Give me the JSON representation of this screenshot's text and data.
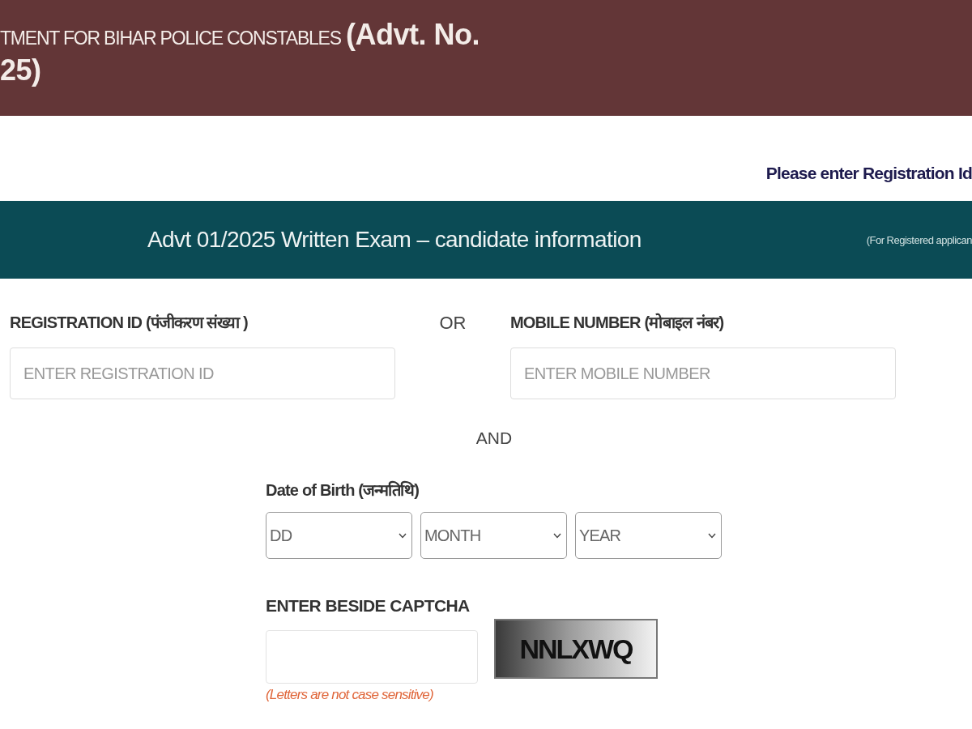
{
  "header": {
    "title": "TMENT FOR BIHAR POLICE CONSTABLES",
    "title_suffix": "(Advt. No.",
    "title_line2": "25)"
  },
  "notice": "Please enter Registration Id",
  "banner": {
    "title": "Advt 01/2025 Written Exam – candidate information",
    "note": "(For Registered applican"
  },
  "registration": {
    "label": "REGISTRATION ID (पंजीकरण संख्या )",
    "placeholder": "ENTER REGISTRATION ID"
  },
  "or_text": "OR",
  "mobile": {
    "label": "MOBILE NUMBER (मोबाइल नंबर)",
    "placeholder": "ENTER MOBILE NUMBER"
  },
  "and_text": "AND",
  "dob": {
    "label": "Date of Birth (जन्मतिथि)",
    "dropdowns": [
      {
        "value": "DD"
      },
      {
        "value": "MONTH"
      },
      {
        "value": "YEAR"
      }
    ]
  },
  "captcha": {
    "label": "ENTER BESIDE CAPTCHA",
    "code": "NNLXWQ",
    "hint": "(Letters are not case sensitive)"
  }
}
